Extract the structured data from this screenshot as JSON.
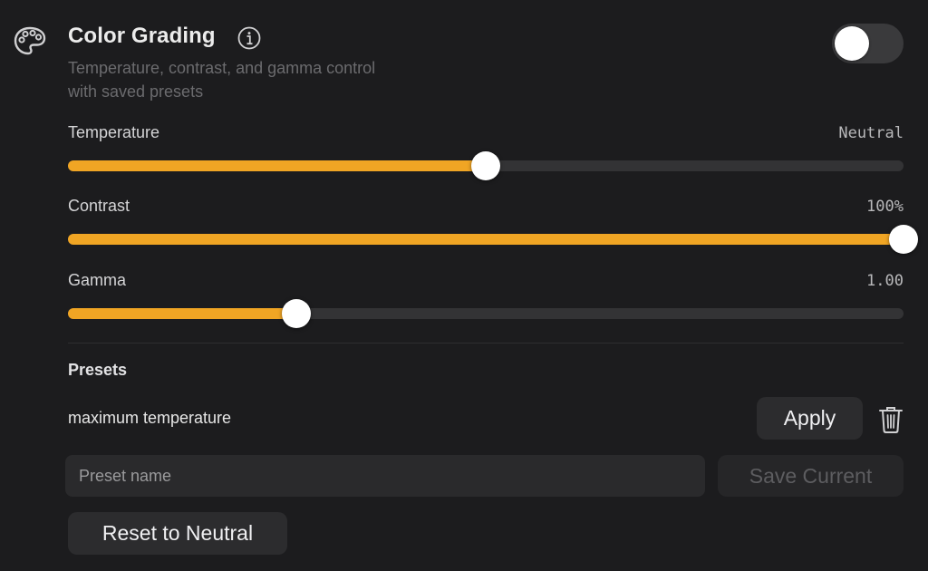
{
  "header": {
    "icon": "palette-icon",
    "title": "Color Grading",
    "info_icon": "info-icon",
    "subtitle_line1": "Temperature, contrast, and gamma control",
    "subtitle_line2": "with saved presets",
    "toggle_on": false
  },
  "sliders": [
    {
      "label": "Temperature",
      "value": "Neutral",
      "fraction": 0.5
    },
    {
      "label": "Contrast",
      "value": "100%",
      "fraction": 1.0
    },
    {
      "label": "Gamma",
      "value": "1.00",
      "fraction": 0.273
    }
  ],
  "presets": {
    "heading": "Presets",
    "items": [
      {
        "name": "maximum temperature",
        "apply_label": "Apply",
        "delete_icon": "trash-icon"
      }
    ],
    "name_placeholder": "Preset name",
    "name_value": "",
    "save_label": "Save Current"
  },
  "reset_label": "Reset to Neutral",
  "colors": {
    "accent": "#f0a524",
    "background": "#1c1c1e",
    "track": "#333335",
    "button": "#2c2c2e"
  }
}
